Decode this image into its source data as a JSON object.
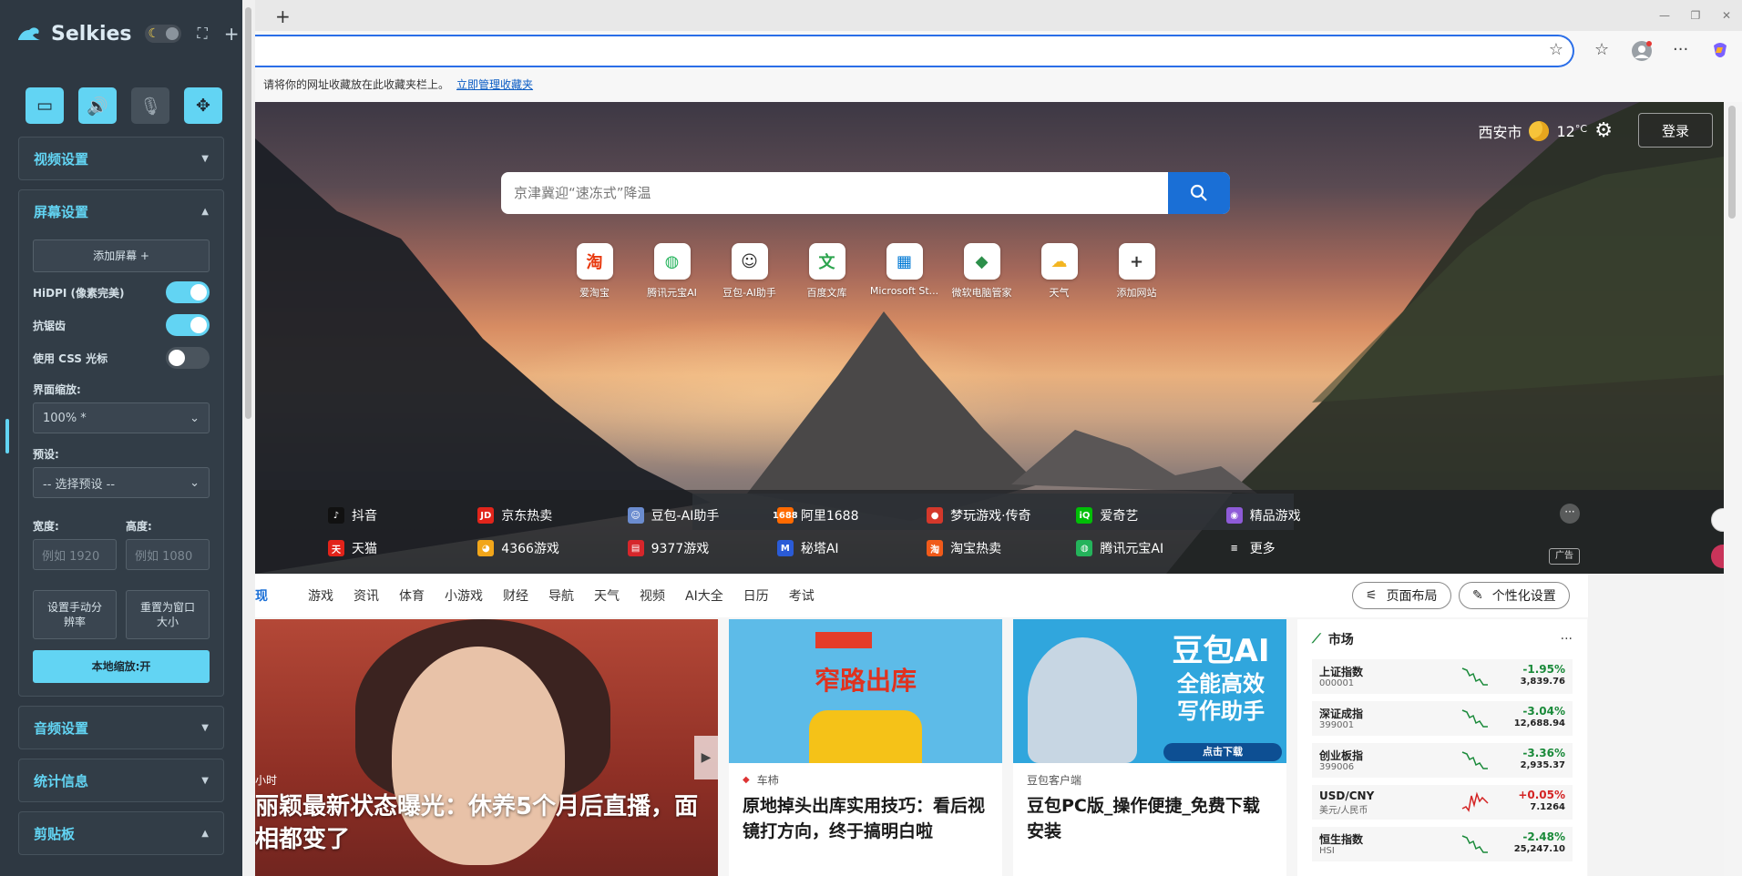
{
  "selkies": {
    "title": "Selkies",
    "tiles": [
      "display",
      "audio",
      "microphone",
      "gamepad"
    ],
    "sections": {
      "video": "视频设置",
      "screen": "屏幕设置",
      "audio": "音频设置",
      "stats": "统计信息",
      "clipboard": "剪贴板"
    },
    "screen": {
      "add_screen": "添加屏幕 +",
      "hidpi": "HiDPI (像素完美)",
      "antialias": "抗锯齿",
      "css_cursor": "使用 CSS 光标",
      "scale_label": "界面缩放:",
      "scale_value": "100% *",
      "preset_label": "预设:",
      "preset_value": "-- 选择预设 --",
      "width_label": "宽度:",
      "height_label": "高度:",
      "width_placeholder": "例如 1920",
      "height_placeholder": "例如 1080",
      "set_manual": "设置手动分辨率",
      "reset_window": "重置为窗口大小",
      "local_scale": "本地缩放:开"
    },
    "toggles": {
      "hidpi": true,
      "antialias": true,
      "css_cursor": false
    }
  },
  "browser": {
    "new_tab": "+",
    "fav_hint": "请将你的网址收藏放在此收藏夹栏上。",
    "fav_link": "立即管理收藏夹"
  },
  "hero": {
    "city": "西安市",
    "temp": "12",
    "temp_unit": "°C",
    "login": "登录",
    "search_placeholder": "京津冀迎“速冻式”降温",
    "quick_links": [
      {
        "label": "爱淘宝",
        "glyph": "淘",
        "color": "#e8380d"
      },
      {
        "label": "腾讯元宝AI",
        "glyph": "◍",
        "color": "#24b35b"
      },
      {
        "label": "豆包-AI助手",
        "glyph": "☺",
        "color": "#333333"
      },
      {
        "label": "百度文库",
        "glyph": "文",
        "color": "#2ca44e"
      },
      {
        "label": "Microsoft St...",
        "glyph": "▦",
        "color": "#0078d4"
      },
      {
        "label": "微软电脑管家",
        "glyph": "◆",
        "color": "#2c8f4a"
      },
      {
        "label": "天气",
        "glyph": "☁",
        "color": "#f3b521"
      },
      {
        "label": "添加网站",
        "glyph": "+",
        "color": "#333333"
      }
    ],
    "hot_row1": [
      {
        "label": "抖音",
        "glyph": "♪",
        "color": "#111111"
      },
      {
        "label": "京东热卖",
        "glyph": "JD",
        "color": "#e1251b"
      },
      {
        "label": "豆包-AI助手",
        "glyph": "☺",
        "color": "#6b8ccf"
      },
      {
        "label": "阿里1688",
        "glyph": "1688",
        "color": "#ff6a00"
      },
      {
        "label": "梦玩游戏·传奇",
        "glyph": "●",
        "color": "#d3382b"
      },
      {
        "label": "爱奇艺",
        "glyph": "iQ",
        "color": "#00be06"
      },
      {
        "label": "精品游戏",
        "glyph": "◉",
        "color": "#8e5bd8"
      }
    ],
    "hot_row2": [
      {
        "label": "天猫",
        "glyph": "天",
        "color": "#e2231a"
      },
      {
        "label": "4366游戏",
        "glyph": "◕",
        "color": "#f2a61a"
      },
      {
        "label": "9377游戏",
        "glyph": "▤",
        "color": "#d6262b"
      },
      {
        "label": "秘塔AI",
        "glyph": "M",
        "color": "#2a5bd7"
      },
      {
        "label": "淘宝热卖",
        "glyph": "淘",
        "color": "#f05a1a"
      },
      {
        "label": "腾讯元宝AI",
        "glyph": "◍",
        "color": "#24b35b"
      },
      {
        "label": "更多",
        "glyph": "≡",
        "color": "transparent"
      }
    ],
    "ad": "广告"
  },
  "feed": {
    "tabs": [
      "现",
      "游戏",
      "资讯",
      "体育",
      "小游戏",
      "财经",
      "导航",
      "天气",
      "视频",
      "AI大全",
      "日历",
      "考试"
    ],
    "layout_btn": "页面布局",
    "personalize_btn": "个性化设置",
    "big": {
      "time": "小时",
      "headline": "丽颖最新状态曝光：休养5个月后直播，面相都变了"
    },
    "card2": {
      "sign": "▮▮▮",
      "image_text": "窄路出库",
      "source": "车柿",
      "title": "原地掉头出库实用技巧：看后视镜打方向，终于搞明白啦"
    },
    "card3": {
      "ad_line1": "豆包AI",
      "ad_line2": "全能高效",
      "ad_line3": "写作助手",
      "download": "点击下载",
      "source": "豆包客户端",
      "title": "豆包PC版_操作便捷_免费下载安装"
    },
    "market": {
      "title": "市场",
      "rows": [
        {
          "name": "上证指数",
          "code": "000001",
          "pct": "-1.95%",
          "price": "3,839.76",
          "dir": "down"
        },
        {
          "name": "深证成指",
          "code": "399001",
          "pct": "-3.04%",
          "price": "12,688.94",
          "dir": "down"
        },
        {
          "name": "创业板指",
          "code": "399006",
          "pct": "-3.36%",
          "price": "2,935.37",
          "dir": "down"
        },
        {
          "name": "USD/CNY",
          "code": "美元/人民币",
          "pct": "+0.05%",
          "price": "7.1264",
          "dir": "up"
        },
        {
          "name": "恒生指数",
          "code": "HSI",
          "pct": "-2.48%",
          "price": "25,247.10",
          "dir": "down"
        }
      ]
    }
  }
}
